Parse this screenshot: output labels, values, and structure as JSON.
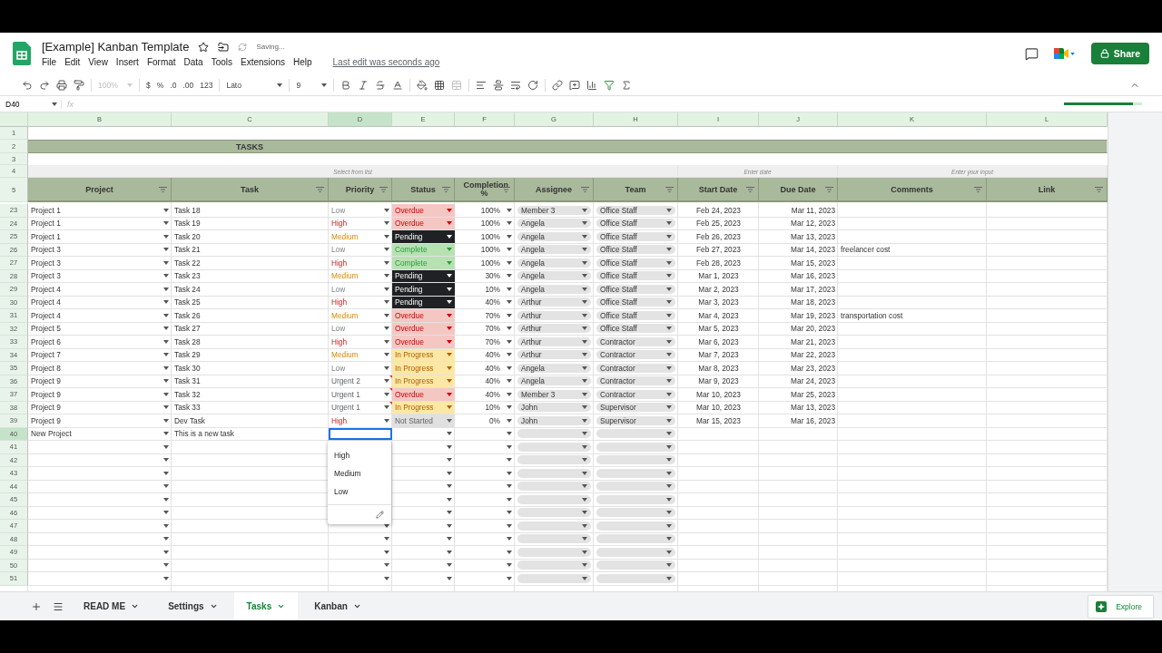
{
  "document": {
    "title": "[Example] Kanban Template",
    "status": "Saving...",
    "last_edit": "Last edit was seconds ago",
    "share": "Share",
    "progress": {
      "level": 0.88
    }
  },
  "menu": [
    "File",
    "Edit",
    "View",
    "Insert",
    "Format",
    "Data",
    "Tools",
    "Extensions",
    "Help"
  ],
  "toolbar": {
    "zoom": {
      "text": "100%",
      "disabled": true
    },
    "currency": "$",
    "percent": "%",
    "decimal_less": ".0",
    "decimal_more": ".00",
    "number_format": "123",
    "font": "Lato",
    "font_size": "9"
  },
  "formula_bar": {
    "cell": "D40",
    "fx": "fx"
  },
  "columns": [
    {
      "letter": "B",
      "selected": false
    },
    {
      "letter": "C",
      "selected": false
    },
    {
      "letter": "D",
      "selected": true
    },
    {
      "letter": "E",
      "selected": false
    },
    {
      "letter": "F",
      "selected": false
    },
    {
      "letter": "G",
      "selected": false
    },
    {
      "letter": "H",
      "selected": false
    },
    {
      "letter": "I",
      "selected": false
    },
    {
      "letter": "J",
      "selected": false
    },
    {
      "letter": "K",
      "selected": false
    },
    {
      "letter": "L",
      "selected": false
    }
  ],
  "top_rows": {
    "nums": [
      "1",
      "2",
      "3",
      "4",
      "5"
    ],
    "title": "TASKS",
    "hints": [
      "Select from list",
      "Enter date",
      "Enter your input"
    ]
  },
  "headers": [
    "Project",
    "Task",
    "Priority",
    "Status",
    "Completion %",
    "Assignee",
    "Team",
    "Start Date",
    "Due Date",
    "Comments",
    "Link"
  ],
  "rows": [
    {
      "num": "23",
      "project": "Project 1",
      "task": "Task 18",
      "priority": {
        "text": "Low",
        "kind": "low"
      },
      "status": {
        "text": "Overdue",
        "kind": "overdue"
      },
      "completion": "100%",
      "assignee": "Member 3",
      "team": "Office Staff",
      "start": "Feb 24, 2023",
      "due": "Mar 11, 2023",
      "selected": false
    },
    {
      "num": "24",
      "project": "Project 1",
      "task": "Task 19",
      "priority": {
        "text": "High",
        "kind": "high"
      },
      "status": {
        "text": "Overdue",
        "kind": "overdue"
      },
      "completion": "100%",
      "assignee": "Angela",
      "team": "Office Staff",
      "start": "Feb 25, 2023",
      "due": "Mar 12, 2023",
      "selected": false
    },
    {
      "num": "25",
      "project": "Project 1",
      "task": "Task 20",
      "priority": {
        "text": "Medium",
        "kind": "medium"
      },
      "status": {
        "text": "Pending",
        "kind": "pending"
      },
      "completion": "100%",
      "assignee": "Angela",
      "team": "Office Staff",
      "start": "Feb 26, 2023",
      "due": "Mar 13, 2023",
      "selected": false
    },
    {
      "num": "26",
      "project": "Project 3",
      "task": "Task 21",
      "priority": {
        "text": "Low",
        "kind": "low"
      },
      "status": {
        "text": "Complete",
        "kind": "complete"
      },
      "completion": "100%",
      "assignee": "Angela",
      "team": "Office Staff",
      "start": "Feb 27, 2023",
      "due": "Mar 14, 2023",
      "comment": "freelancer cost",
      "selected": false
    },
    {
      "num": "27",
      "project": "Project 3",
      "task": "Task 22",
      "priority": {
        "text": "High",
        "kind": "high"
      },
      "status": {
        "text": "Complete",
        "kind": "complete"
      },
      "completion": "100%",
      "assignee": "Angela",
      "team": "Office Staff",
      "start": "Feb 28, 2023",
      "due": "Mar 15, 2023",
      "selected": false
    },
    {
      "num": "28",
      "project": "Project 3",
      "task": "Task 23",
      "priority": {
        "text": "Medium",
        "kind": "medium"
      },
      "status": {
        "text": "Pending",
        "kind": "pending"
      },
      "completion": "30%",
      "assignee": "Angela",
      "team": "Office Staff",
      "start": "Mar 1, 2023",
      "due": "Mar 16, 2023",
      "selected": false
    },
    {
      "num": "29",
      "project": "Project 4",
      "task": "Task 24",
      "priority": {
        "text": "Low",
        "kind": "low"
      },
      "status": {
        "text": "Pending",
        "kind": "pending"
      },
      "completion": "10%",
      "assignee": "Angela",
      "team": "Office Staff",
      "start": "Mar 2, 2023",
      "due": "Mar 17, 2023",
      "selected": false
    },
    {
      "num": "30",
      "project": "Project 4",
      "task": "Task 25",
      "priority": {
        "text": "High",
        "kind": "high"
      },
      "status": {
        "text": "Pending",
        "kind": "pending"
      },
      "completion": "40%",
      "assignee": "Arthur",
      "team": "Office Staff",
      "start": "Mar 3, 2023",
      "due": "Mar 18, 2023",
      "selected": false
    },
    {
      "num": "31",
      "project": "Project 4",
      "task": "Task 26",
      "priority": {
        "text": "Medium",
        "kind": "medium"
      },
      "status": {
        "text": "Overdue",
        "kind": "overdue"
      },
      "completion": "70%",
      "assignee": "Arthur",
      "team": "Office Staff",
      "start": "Mar 4, 2023",
      "due": "Mar 19, 2023",
      "comment": "transportation cost",
      "selected": false
    },
    {
      "num": "32",
      "project": "Project 5",
      "task": "Task 27",
      "priority": {
        "text": "Low",
        "kind": "low"
      },
      "status": {
        "text": "Overdue",
        "kind": "overdue"
      },
      "completion": "70%",
      "assignee": "Arthur",
      "team": "Office Staff",
      "start": "Mar 5, 2023",
      "due": "Mar 20, 2023",
      "selected": false
    },
    {
      "num": "33",
      "project": "Project 6",
      "task": "Task 28",
      "priority": {
        "text": "High",
        "kind": "high"
      },
      "status": {
        "text": "Overdue",
        "kind": "overdue"
      },
      "completion": "70%",
      "assignee": "Arthur",
      "team": "Contractor",
      "start": "Mar 6, 2023",
      "due": "Mar 21, 2023",
      "selected": false
    },
    {
      "num": "34",
      "project": "Project 7",
      "task": "Task 29",
      "priority": {
        "text": "Medium",
        "kind": "medium"
      },
      "status": {
        "text": "In Progress",
        "kind": "progress"
      },
      "completion": "40%",
      "assignee": "Arthur",
      "team": "Contractor",
      "start": "Mar 7, 2023",
      "due": "Mar 22, 2023",
      "selected": false
    },
    {
      "num": "35",
      "project": "Project 8",
      "task": "Task 30",
      "priority": {
        "text": "Low",
        "kind": "low"
      },
      "status": {
        "text": "In Progress",
        "kind": "progress"
      },
      "completion": "40%",
      "assignee": "Angela",
      "team": "Contractor",
      "start": "Mar 8, 2023",
      "due": "Mar 23, 2023",
      "selected": false
    },
    {
      "num": "36",
      "project": "Project 9",
      "task": "Task 31",
      "priority": {
        "text": "Urgent 2",
        "kind": "urgent"
      },
      "status": {
        "text": "In Progress",
        "kind": "progress"
      },
      "completion": "40%",
      "assignee": "Angela",
      "team": "Contractor",
      "start": "Mar 9, 2023",
      "due": "Mar 24, 2023",
      "note": true,
      "selected": false
    },
    {
      "num": "37",
      "project": "Project 9",
      "task": "Task 32",
      "priority": {
        "text": "Urgent 1",
        "kind": "urgent"
      },
      "status": {
        "text": "Overdue",
        "kind": "overdue"
      },
      "completion": "40%",
      "assignee": "Member 3",
      "team": "Contractor",
      "start": "Mar 10, 2023",
      "due": "Mar 25, 2023",
      "note": true,
      "selected": false
    },
    {
      "num": "38",
      "project": "Project 9",
      "task": "Task 33",
      "priority": {
        "text": "Urgent 1",
        "kind": "urgent"
      },
      "status": {
        "text": "In Progress",
        "kind": "progress"
      },
      "completion": "10%",
      "assignee": "John",
      "team": "Supervisor",
      "start": "Mar 10, 2023",
      "due": "Mar 13, 2023",
      "note": true,
      "selected": false
    },
    {
      "num": "39",
      "project": "Project 9",
      "task": "Dev Task",
      "priority": {
        "text": "High",
        "kind": "high"
      },
      "status": {
        "text": "Not Started",
        "kind": "notstarted"
      },
      "completion": "0%",
      "assignee": "John",
      "team": "Supervisor",
      "start": "Mar 15, 2023",
      "due": "Mar 16, 2023",
      "selected": false
    },
    {
      "num": "40",
      "project": "New Project",
      "task": "This is a new task",
      "selected": true
    },
    {
      "num": "41",
      "selected": false
    },
    {
      "num": "42",
      "selected": false
    },
    {
      "num": "43",
      "selected": false
    },
    {
      "num": "44",
      "selected": false
    },
    {
      "num": "45",
      "selected": false
    },
    {
      "num": "46",
      "selected": false
    },
    {
      "num": "47",
      "selected": false
    },
    {
      "num": "48",
      "selected": false
    },
    {
      "num": "49",
      "selected": false
    },
    {
      "num": "50",
      "selected": false
    },
    {
      "num": "51",
      "selected": false
    }
  ],
  "dropdown": {
    "options": [
      "High",
      "Medium",
      "Low"
    ]
  },
  "sheet_tabs": [
    {
      "label": "READ ME",
      "selected": false
    },
    {
      "label": "Settings",
      "selected": false
    },
    {
      "label": "Tasks",
      "selected": true
    },
    {
      "label": "Kanban",
      "selected": false
    }
  ],
  "explore": "Explore"
}
